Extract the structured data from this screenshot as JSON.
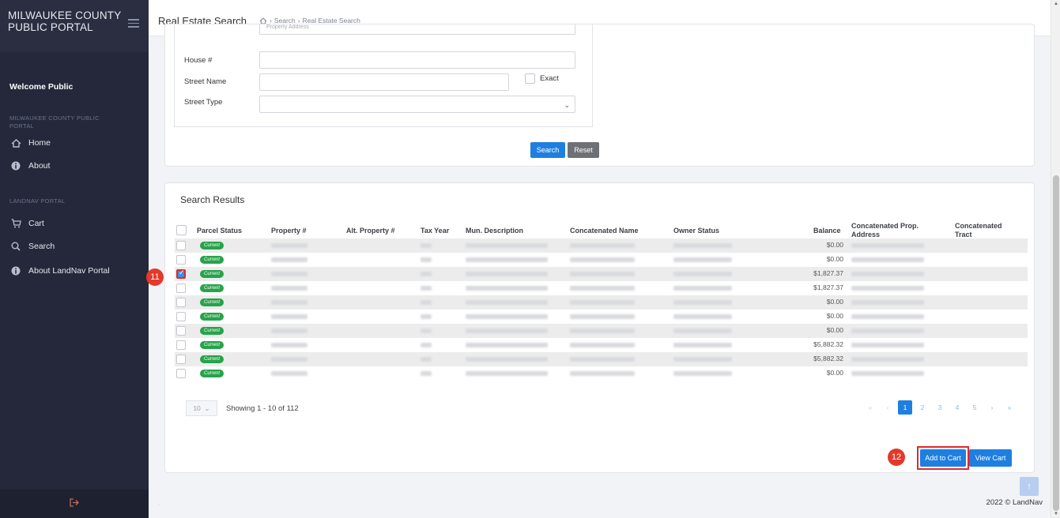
{
  "sidebar": {
    "brand_line1": "MILWAUKEE COUNTY",
    "brand_line2": "PUBLIC PORTAL",
    "welcome": "Welcome Public",
    "section1_label": "MILWAUKEE COUNTY PUBLIC PORTAL",
    "section2_label": "LANDNAV PORTAL",
    "items": [
      {
        "label": "Home",
        "icon": "home-icon"
      },
      {
        "label": "About",
        "icon": "info-icon"
      },
      {
        "label": "Cart",
        "icon": "cart-icon"
      },
      {
        "label": "Search",
        "icon": "search-icon"
      },
      {
        "label": "About LandNav Portal",
        "icon": "info-icon"
      }
    ],
    "footer_icon": "logout-icon"
  },
  "topbar": {
    "title": "Real Estate Search",
    "breadcrumb": [
      "Search",
      "Real Estate Search"
    ]
  },
  "search_form": {
    "cut_select_text": "Property Address",
    "house_label": "House #",
    "house_value": "",
    "street_name_label": "Street Name",
    "street_name_value": "",
    "exact_label": "Exact",
    "street_type_label": "Street Type",
    "street_type_value": "",
    "search_button": "Search",
    "reset_button": "Reset"
  },
  "results": {
    "title": "Search Results",
    "columns": [
      "Parcel Status",
      "Property #",
      "Alt. Property #",
      "Tax Year",
      "Mun. Description",
      "Concatenated Name",
      "Owner Status",
      "Balance",
      "Concatenated Prop. Address",
      "Concatenated Tract"
    ],
    "rows": [
      {
        "status": "Current",
        "balance": "$0.00",
        "checked": false
      },
      {
        "status": "Current",
        "balance": "$0.00",
        "checked": false
      },
      {
        "status": "Current",
        "balance": "$1,827.37",
        "checked": true
      },
      {
        "status": "Current",
        "balance": "$1,827.37",
        "checked": false
      },
      {
        "status": "Current",
        "balance": "$0.00",
        "checked": false
      },
      {
        "status": "Current",
        "balance": "$0.00",
        "checked": false
      },
      {
        "status": "Current",
        "balance": "$0.00",
        "checked": false
      },
      {
        "status": "Current",
        "balance": "$5,882.32",
        "checked": false
      },
      {
        "status": "Current",
        "balance": "$5,882.32",
        "checked": false
      },
      {
        "status": "Current",
        "balance": "$0.00",
        "checked": false
      }
    ],
    "page_size": "10",
    "showing": "Showing 1 - 10 of 112",
    "pages": [
      "1",
      "2",
      "3",
      "4",
      "5"
    ],
    "current_page": "1",
    "add_to_cart": "Add to Cart",
    "view_cart": "View Cart"
  },
  "markers": {
    "step_11": "11",
    "step_12": "12"
  },
  "footer": {
    "copyright": "2022 © LandNav"
  },
  "colors": {
    "primary": "#1e7fe0",
    "sidebar": "#24283a",
    "status_green": "#27a34a",
    "marker_red": "#e23a2a"
  }
}
